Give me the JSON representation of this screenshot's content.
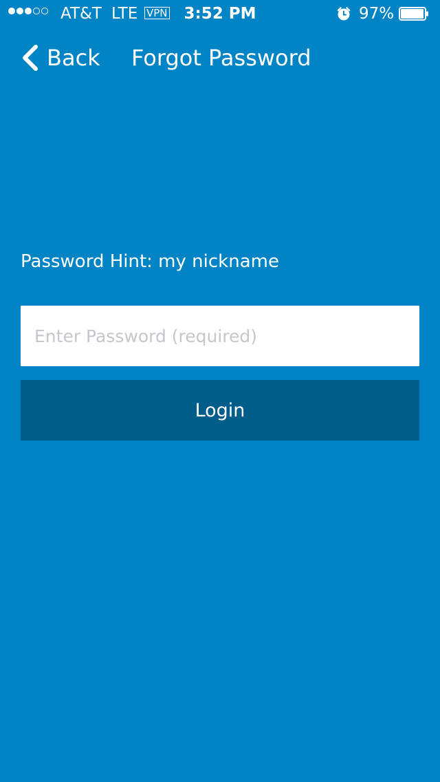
{
  "status_bar": {
    "signal": {
      "filled_dots": 3,
      "total_dots": 5
    },
    "carrier": "AT&T",
    "network": "LTE",
    "vpn": "VPN",
    "time": "3:52 PM",
    "alarm_icon": "alarm-clock-icon",
    "battery_percent": "97%",
    "battery_level": 0.97
  },
  "nav": {
    "back_icon": "chevron-left-icon",
    "back_label": "Back",
    "title": "Forgot Password"
  },
  "form": {
    "hint": "Password Hint: my nickname",
    "password_value": "",
    "password_placeholder": "Enter Password (required)",
    "login_label": "Login"
  },
  "colors": {
    "background": "#0084c6",
    "login_button": "#005d8a",
    "input_background": "#ffffff",
    "placeholder_text": "#c6c6cc"
  }
}
